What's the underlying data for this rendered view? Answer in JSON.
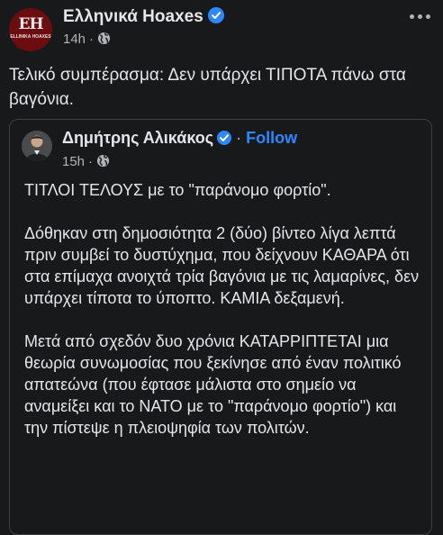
{
  "post": {
    "page_name": "Ελληνικά Hoaxes",
    "avatar_text": "EH",
    "avatar_subtext": "ELLINIKA HOAXES",
    "time": "14h",
    "dot": "·",
    "text": "Τελικό συμπέρασμα: Δεν υπάρχει ΤΙΠΟΤΑ πάνω στα βαγόνια."
  },
  "shared": {
    "author_name": "Δημήτρης Αλικάκος",
    "separator": "·",
    "follow_label": "Follow",
    "time": "15h",
    "dot": "·",
    "paragraphs": [
      "ΤΙΤΛΟΙ ΤΕΛΟΥΣ με το \"παράνομο φορτίο\".",
      "Δόθηκαν στη δημοσιότητα 2 (δύο) βίντεο λίγα λεπτά πριν συμβεί το δυστύχημα, που δείχνουν ΚΑΘΑΡΑ ότι στα επίμαχα ανοιχτά τρία βαγόνια με τις λαμαρίνες, δεν υπάρχει τίποτα το ύποπτο. ΚΑΜΙΑ δεξαμενή.",
      "Μετά από σχεδόν δυο χρόνια ΚΑΤΑΡΡΙΠΤΕΤΑΙ μια θεωρία συνωμοσίας που ξεκίνησε από έναν πολιτικό απατεώνα (που έφτασε μάλιστα στο σημείο να αναμείξει και το ΝΑΤΟ με το \"παράνομο φορτίο\") και την πίστεψε η πλειοψηφία των πολιτών."
    ]
  },
  "colors": {
    "background": "#18191a",
    "text": "#e4e6eb",
    "secondary": "#b0b3b8",
    "accent": "#2d88ff",
    "avatar_bg": "#6b0d10"
  },
  "icons": [
    "verified-badge-icon",
    "globe-icon",
    "more-options-icon"
  ]
}
